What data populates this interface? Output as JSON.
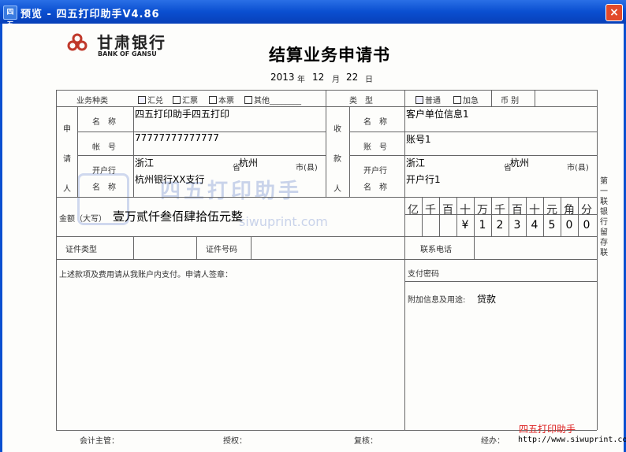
{
  "window": {
    "title": "预览 - 四五打印助手V4.86",
    "app_icon": "四五",
    "close_label": "×"
  },
  "bank": {
    "name_cn": "甘肃银行",
    "name_en": "BANK OF GANSU"
  },
  "form": {
    "title": "结算业务申请书",
    "date_year": "2013",
    "date_month": "12",
    "date_day": "22",
    "labels": {
      "year": "年",
      "month": "月",
      "day": "日",
      "business_type": "业务种类",
      "category": "类　型",
      "currency": "币 别",
      "applicant": "申请人",
      "payee": "收款人",
      "name": "名　称",
      "account": "帐　号",
      "account2": "账　号",
      "bank_open": "开户行",
      "bank_name": "名　称",
      "province": "省",
      "city": "市(县)",
      "amount": "金额（大写）",
      "id_type": "证件类型",
      "id_number": "证件号码",
      "phone": "联系电话",
      "payment_password": "支付密码",
      "extra_info": "附加信息及用途:",
      "consent": "上述款项及费用请从我账户内支付。申请人签章："
    },
    "options": {
      "remit": "汇兑",
      "draft": "汇票",
      "cashier": "本票",
      "other": "其他________",
      "normal": "普通",
      "urgent": "加急"
    },
    "applicant": {
      "name": "四五打印助手四五打印",
      "account": "77777777777777",
      "province": "浙江",
      "city": "杭州",
      "bank": "杭州银行XX支行"
    },
    "payee": {
      "name": "客户单位信息1",
      "account": "账号1",
      "province": "浙江",
      "city": "杭州",
      "bank": "开户行1"
    },
    "amount_words": "壹万贰仟叁佰肆拾伍元整",
    "digit_headers": [
      "亿",
      "千",
      "百",
      "十",
      "万",
      "千",
      "百",
      "十",
      "元",
      "角",
      "分"
    ],
    "digits": [
      "",
      "",
      "",
      "¥",
      "1",
      "2",
      "3",
      "4",
      "5",
      "0",
      "0"
    ],
    "purpose": "贷款",
    "side_note": "第一联 银行留存联",
    "footer": {
      "supervisor": "会计主管：",
      "authorize": "授权：",
      "review": "复核：",
      "handler": "经办："
    }
  },
  "watermark": {
    "text": "四五打印助手",
    "url": "siwuprint.com"
  },
  "branding": {
    "name": "四五打印助手",
    "url": "http://www.siwuprint.com"
  }
}
